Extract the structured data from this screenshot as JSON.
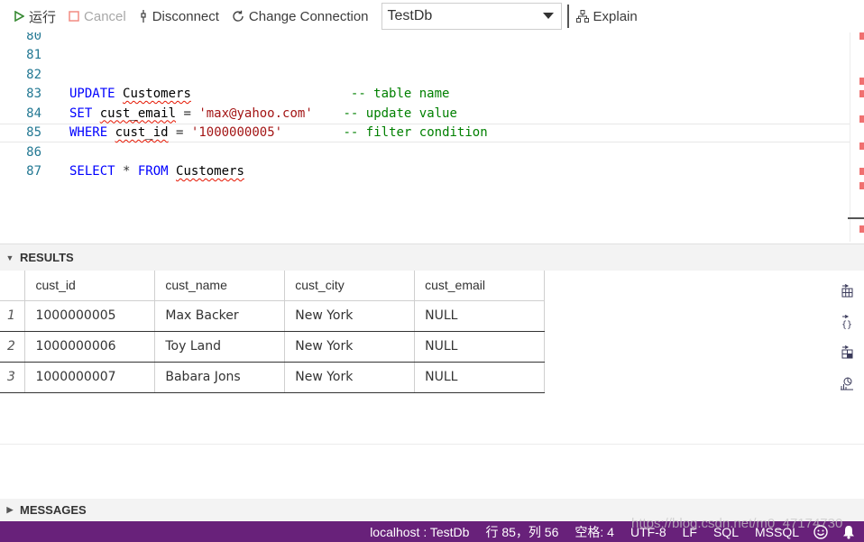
{
  "toolbar": {
    "run_label": "运行",
    "cancel_label": "Cancel",
    "disconnect_label": "Disconnect",
    "change_connection_label": "Change Connection",
    "database_selected": "TestDb",
    "explain_label": "Explain",
    "icons": {
      "run": "play-icon",
      "cancel": "stop-square-icon",
      "disconnect": "unplug-icon",
      "change_connection": "refresh-icon",
      "dropdown": "chevron-down-icon",
      "explain": "hierarchy-icon"
    },
    "colors": {
      "run_icon": "#388a34",
      "cancel_icon": "#f28b82"
    }
  },
  "editor": {
    "lines": [
      {
        "number": "80",
        "tokens": []
      },
      {
        "number": "81",
        "tokens": []
      },
      {
        "number": "82",
        "tokens": []
      },
      {
        "number": "83",
        "tokens": [
          {
            "text": "UPDATE",
            "kind": "kw"
          },
          {
            "text": " ",
            "kind": "plain"
          },
          {
            "text": "Customers",
            "kind": "id",
            "squiggle": true
          },
          {
            "text": "                     ",
            "kind": "plain"
          },
          {
            "text": "-- table name",
            "kind": "cm"
          }
        ]
      },
      {
        "number": "84",
        "tokens": [
          {
            "text": "SET",
            "kind": "kw"
          },
          {
            "text": " ",
            "kind": "plain"
          },
          {
            "text": "cust_email",
            "kind": "id",
            "squiggle": true
          },
          {
            "text": " = ",
            "kind": "plain"
          },
          {
            "text": "'max@yahoo.com'",
            "kind": "str"
          },
          {
            "text": "    ",
            "kind": "plain"
          },
          {
            "text": "-- update value",
            "kind": "cm"
          }
        ]
      },
      {
        "number": "85",
        "current": true,
        "tokens": [
          {
            "text": "WHERE",
            "kind": "kw"
          },
          {
            "text": " ",
            "kind": "plain"
          },
          {
            "text": "cust_id",
            "kind": "id",
            "squiggle": true
          },
          {
            "text": " = ",
            "kind": "plain"
          },
          {
            "text": "'1000000005'",
            "kind": "str"
          },
          {
            "text": "        ",
            "kind": "plain"
          },
          {
            "text": "-- filter condition",
            "kind": "cm"
          }
        ]
      },
      {
        "number": "86",
        "tokens": []
      },
      {
        "number": "87",
        "tokens": [
          {
            "text": "SELECT",
            "kind": "kw"
          },
          {
            "text": " * ",
            "kind": "plain"
          },
          {
            "text": "FROM",
            "kind": "kw"
          },
          {
            "text": " ",
            "kind": "plain"
          },
          {
            "text": "Customers",
            "kind": "id",
            "squiggle": true
          }
        ]
      }
    ],
    "colors": {
      "keyword": "#0000ff",
      "string": "#a31515",
      "comment": "#008000",
      "line_number": "#237893",
      "squiggle": "#e51400"
    }
  },
  "results": {
    "title": "RESULTS",
    "columns": [
      "cust_id",
      "cust_name",
      "cust_city",
      "cust_email"
    ],
    "rows": [
      {
        "row_number": "1",
        "cells": [
          "1000000005",
          "Max Backer",
          "New York",
          "NULL"
        ]
      },
      {
        "row_number": "2",
        "cells": [
          "1000000006",
          "Toy Land",
          "New York",
          "NULL"
        ]
      },
      {
        "row_number": "3",
        "cells": [
          "1000000007",
          "Babara Jons",
          "New York",
          "NULL"
        ]
      }
    ],
    "side_icons": [
      "save-csv-icon",
      "save-json-icon",
      "save-excel-icon",
      "chart-icon"
    ]
  },
  "messages": {
    "title": "MESSAGES"
  },
  "statusbar": {
    "connection": "localhost : TestDb",
    "position": "行 85，列 56",
    "indent": "空格: 4",
    "encoding": "UTF-8",
    "eol": "LF",
    "language": "SQL",
    "dialect": "MSSQL",
    "icons": [
      "smiley-feedback-icon",
      "bell-icon"
    ],
    "color": "#68217a"
  },
  "watermark": "https://blog.csdn.net/m0_47174730"
}
